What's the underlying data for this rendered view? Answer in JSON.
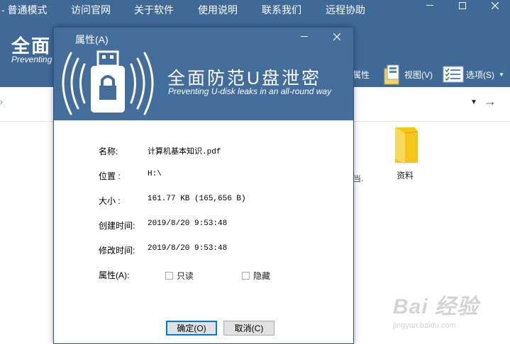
{
  "menu": {
    "items": [
      "- 普通模式",
      "访问官网",
      "关于软件",
      "使用说明",
      "联系我们",
      "远程协助"
    ]
  },
  "app": {
    "title": "全面",
    "subtitle": "Preventing",
    "toolbar": {
      "attr_label": "属性",
      "view_label": "视图(V)",
      "options_label": "选项(S)"
    },
    "folder_label": "资料",
    "file_fragment": "当."
  },
  "watermark": {
    "main": "Bai 经验",
    "sub": "jingyan.baidu.com"
  },
  "dialog": {
    "title": "属性(A)",
    "brand_title": "全面防范U盘泄密",
    "brand_subtitle": "Preventing U-disk leaks in an all-round way",
    "props": {
      "name_label": "名称:",
      "name_value": "计算机基本知识.pdf",
      "location_label": "位置 :",
      "location_value": "H:\\",
      "size_label": "大小 :",
      "size_value": "161.77 KB (165,656 B)",
      "created_label": "创建时间:",
      "created_value": "2019/8/20 9:53:48",
      "modified_label": "修改时间:",
      "modified_value": "2019/8/20 9:53:48",
      "attr_label": "属性(A):",
      "readonly_label": "只读",
      "hidden_label": "隐藏"
    },
    "buttons": {
      "ok": "确定(O)",
      "cancel": "取消(C)"
    }
  },
  "colors": {
    "header_blue": "#3f6a98",
    "dialog_header": "#436d9b",
    "folder_yellow": "#f5c518"
  }
}
